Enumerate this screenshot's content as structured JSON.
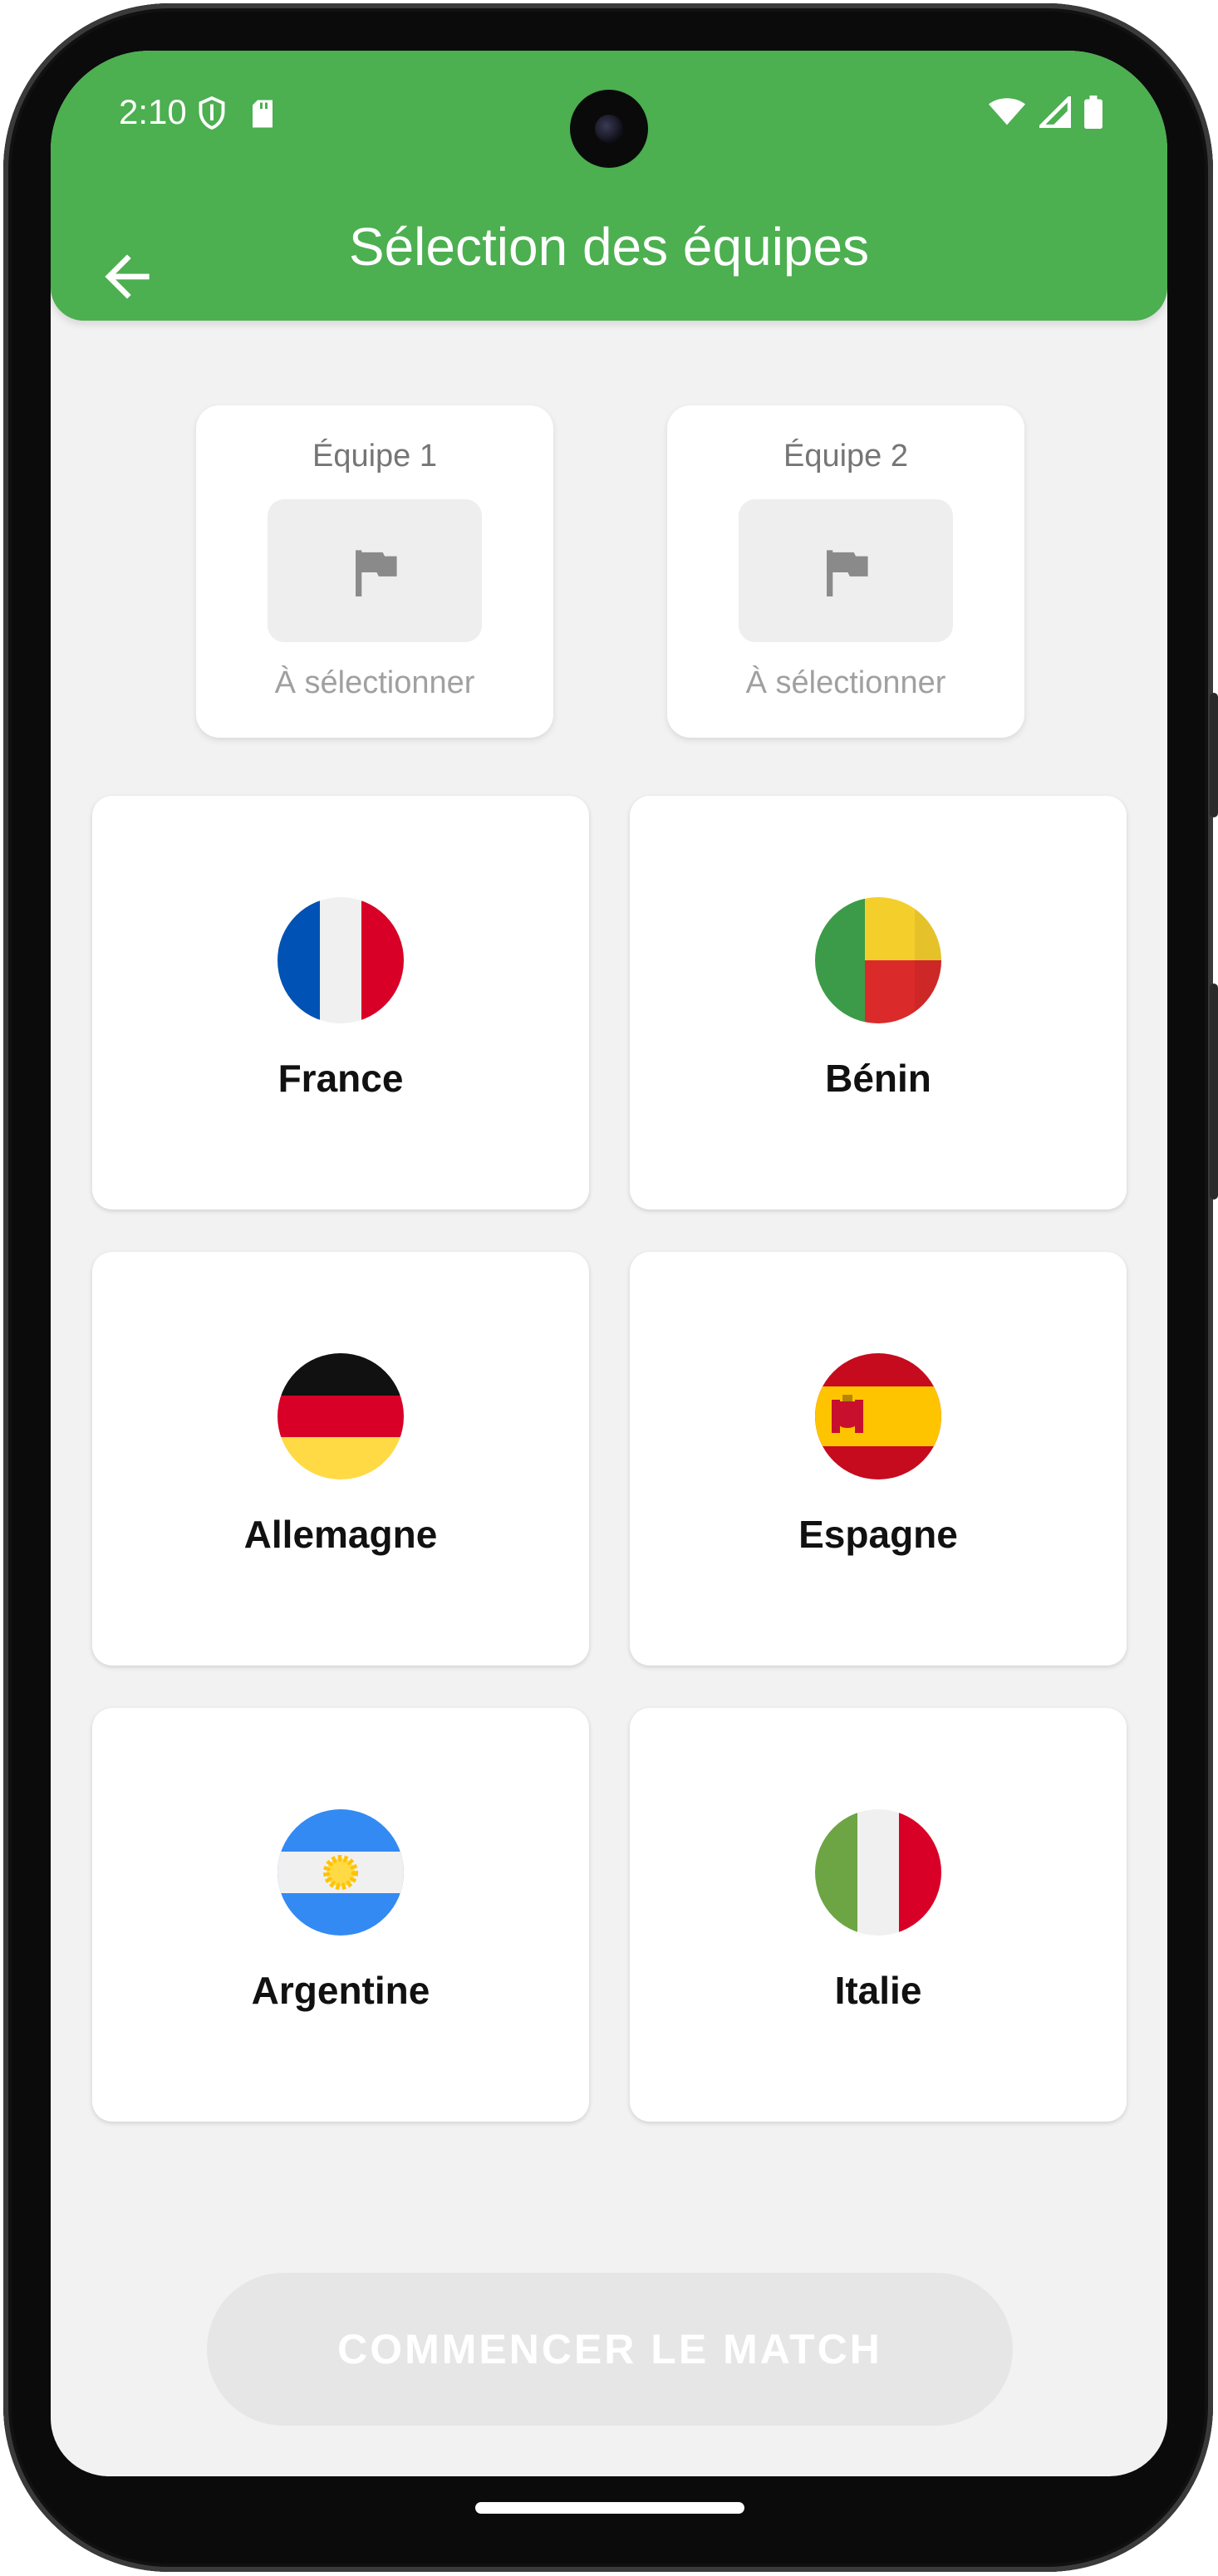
{
  "status_bar": {
    "time": "2:10"
  },
  "app_bar": {
    "title": "Sélection des équipes"
  },
  "slots": [
    {
      "label": "Équipe 1",
      "status": "À sélectionner"
    },
    {
      "label": "Équipe 2",
      "status": "À sélectionner"
    }
  ],
  "teams": [
    {
      "name": "France"
    },
    {
      "name": "Bénin"
    },
    {
      "name": "Allemagne"
    },
    {
      "name": "Espagne"
    },
    {
      "name": "Argentine"
    },
    {
      "name": "Italie"
    }
  ],
  "actions": {
    "start_label": "COMMENCER LE MATCH"
  },
  "colors": {
    "accent": "#4caf50",
    "background": "#f2f2f2",
    "disabled": "#e6e6e6"
  }
}
